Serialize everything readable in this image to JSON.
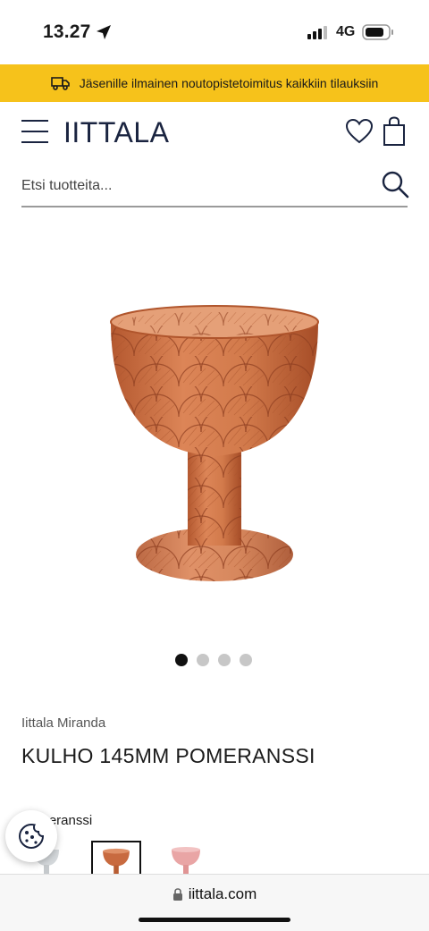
{
  "status_bar": {
    "time": "13.27",
    "network": "4G"
  },
  "promo": {
    "text": "Jäsenille ilmainen noutopistetoimitus kaikkiin tilauksiin",
    "icon": "truck-icon"
  },
  "header": {
    "logo": "IITTALA",
    "icons": [
      "menu-icon",
      "heart-icon",
      "bag-icon"
    ]
  },
  "search": {
    "placeholder": "Etsi tuotteita...",
    "icon": "search-icon"
  },
  "gallery": {
    "image_count": 4,
    "active_index": 0
  },
  "product": {
    "brand": "Iittala Miranda",
    "title": "KULHO 145MM POMERANSSI",
    "color_label": "Pomeranssi",
    "colors": {
      "pomeranssi": "#c86a3f",
      "clear": "#cfd3d6",
      "pink": "#e9a5a5"
    }
  },
  "browser": {
    "url": "iittala.com"
  },
  "colors": {
    "promo_bg": "#f6c21b",
    "brand_navy": "#1a2440"
  }
}
